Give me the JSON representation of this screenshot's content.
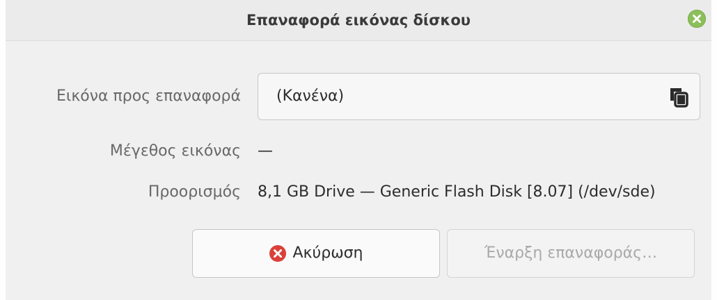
{
  "window": {
    "title": "Επαναφορά εικόνας δίσκου"
  },
  "form": {
    "image_label": "Εικόνα προς επαναφορά",
    "image_value": "(Κανένα)",
    "size_label": "Μέγεθος εικόνας",
    "size_value": "—",
    "destination_label": "Προορισμός",
    "destination_value": "8,1 GB Drive — Generic Flash Disk [8.07] (/dev/sde)"
  },
  "buttons": {
    "cancel_label": "Ακύρωση",
    "start_label": "Έναρξη επαναφοράς…"
  },
  "icons": {
    "close": "close-icon",
    "file_chooser": "copy-files-icon",
    "cancel": "cancel-icon"
  },
  "colors": {
    "close_button": "#8cbf5a",
    "cancel_icon": "#d9413a"
  }
}
